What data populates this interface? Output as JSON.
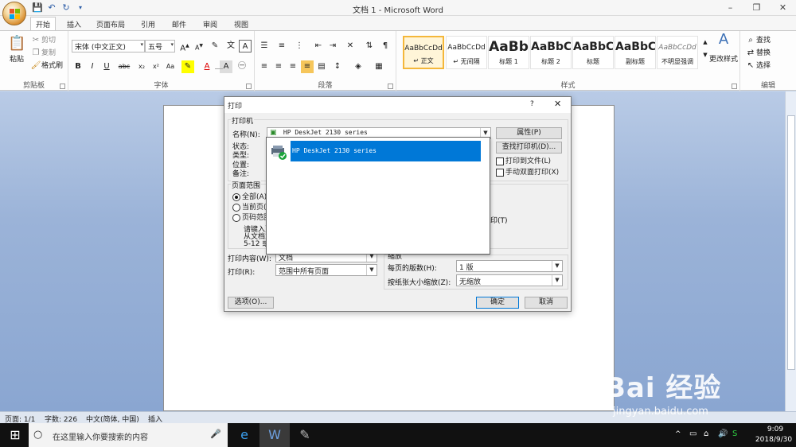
{
  "window": {
    "title": "文档 1 - Microsoft Word",
    "controls": {
      "minimize": "–",
      "restore": "❐",
      "close": "✕"
    }
  },
  "tabs": [
    "开始",
    "插入",
    "页面布局",
    "引用",
    "邮件",
    "审阅",
    "视图"
  ],
  "ribbon": {
    "clipboard": {
      "paste": "粘贴",
      "cut": "剪切",
      "copy": "复制",
      "format_painter": "格式刷",
      "label": "剪贴板"
    },
    "font": {
      "name": "宋体 (中文正文)",
      "size": "五号",
      "label": "字体"
    },
    "paragraph": {
      "label": "段落"
    },
    "styles": {
      "label": "样式",
      "items": [
        {
          "sample": "AaBbCcDd",
          "name": "↵ 正文"
        },
        {
          "sample": "AaBbCcDd",
          "name": "↵ 无间隔"
        },
        {
          "sample": "AaBb",
          "name": "标题 1"
        },
        {
          "sample": "AaBbC",
          "name": "标题 2"
        },
        {
          "sample": "AaBbC",
          "name": "标题"
        },
        {
          "sample": "AaBbC",
          "name": "副标题"
        },
        {
          "sample": "AaBbCcDd",
          "name": "不明显强调"
        }
      ],
      "change_styles": "更改样式"
    },
    "editing": {
      "find": "查找",
      "replace": "替换",
      "select": "选择",
      "label": "编辑"
    }
  },
  "statusbar": {
    "page": "页面: 1/1",
    "words": "字数: 226",
    "language": "中文(简体, 中国)",
    "mode": "插入"
  },
  "taskbar": {
    "search_placeholder": "在这里输入你要搜索的内容",
    "time": "9:09",
    "date": "2018/9/30"
  },
  "dialog": {
    "title": "打印",
    "help": "?",
    "close": "✕",
    "printer_section": "打印机",
    "name_label": "名称(N):",
    "printer_name": "HP DeskJet 2130 series",
    "status_label": "状态:",
    "type_label": "类型:",
    "where_label": "位置:",
    "comment_label": "备注:",
    "properties_button": "属性(P)",
    "find_printer_button": "查找打印机(D)...",
    "print_to_file": "打印到文件(L)",
    "manual_duplex": "手动双面打印(X)",
    "page_range_label": "页面范围",
    "all_pages": "全部(A)",
    "current_page": "当前页(",
    "pages": "页码范围",
    "range_hint_1": "请键入页",
    "range_hint_2": "从文档或",
    "range_hint_3": "5-12 或",
    "print_what_label": "打印内容(W):",
    "print_what_value": "文档",
    "print_label": "打印(R):",
    "print_value": "范围中所有页面",
    "collate_partial": "印(T)",
    "zoom_label": "缩放",
    "pages_per_sheet_label": "每页的版数(H):",
    "pages_per_sheet_value": "1 版",
    "scale_label": "按纸张大小缩放(Z):",
    "scale_value": "无缩放",
    "options_button": "选项(O)...",
    "ok_button": "确定",
    "cancel_button": "取消"
  },
  "dropdown": {
    "selected_printer": "HP DeskJet 2130 series"
  },
  "watermark": {
    "brand": "Bai 经验",
    "url": "jingyan.baidu.com"
  },
  "colors": {
    "selection": "#0078d7",
    "office_accent": "#d88a2a"
  }
}
